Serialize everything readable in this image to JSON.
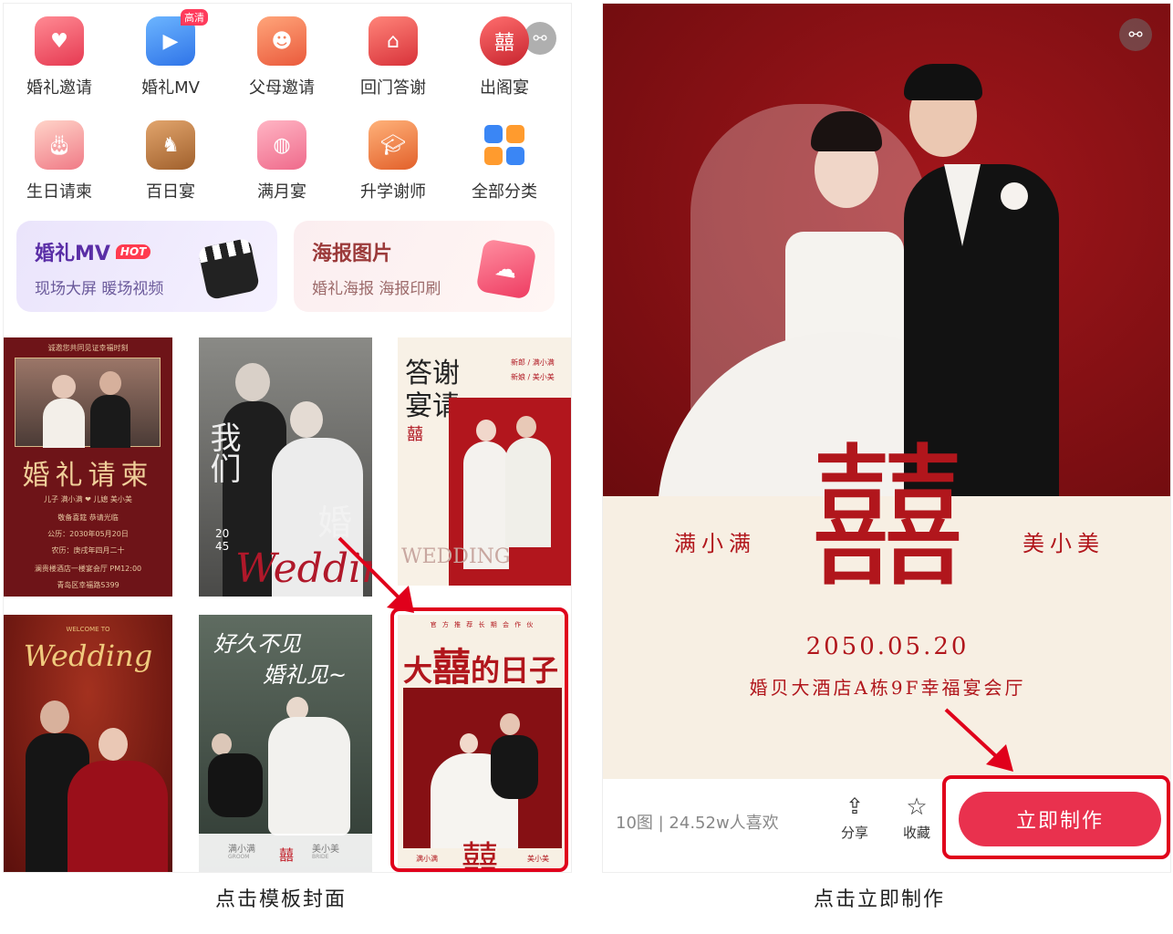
{
  "left_panel": {
    "categories_row1": [
      {
        "label": "婚礼邀请",
        "icon": "envelope-heart-icon",
        "color": "#f25d6b"
      },
      {
        "label": "婚礼MV",
        "icon": "video-icon",
        "color": "#3a8cf0",
        "tag": "高清"
      },
      {
        "label": "父母邀请",
        "icon": "parents-card-icon",
        "color": "#f07552"
      },
      {
        "label": "回门答谢",
        "icon": "pagoda-icon",
        "color": "#ef4e4e"
      },
      {
        "label": "出阁宴",
        "icon": "bride-icon",
        "color": "#e0434b"
      }
    ],
    "categories_row2": [
      {
        "label": "生日请柬",
        "icon": "cake-icon",
        "color": "#f59aa0"
      },
      {
        "label": "百日宴",
        "icon": "rocking-horse-icon",
        "color": "#b8763e"
      },
      {
        "label": "满月宴",
        "icon": "baby-bottle-icon",
        "color": "#f48aa3"
      },
      {
        "label": "升学谢师",
        "icon": "graduation-cap-icon",
        "color": "#ef7a3c"
      },
      {
        "label": "全部分类",
        "icon": "grid-icon",
        "color": "#3b8ef2"
      }
    ],
    "promo_mv": {
      "title": "婚礼MV",
      "badge": "HOT",
      "subtitle": "现场大屏 暖场视频",
      "icon": "clapperboard-icon"
    },
    "promo_poster": {
      "title": "海报图片",
      "subtitle": "婚礼海报 海报印刷",
      "icon": "picture-icon"
    },
    "templates": [
      {
        "name": "婚礼请柬",
        "header": "诚邀您共同见证幸福时刻",
        "line1": "儿子  满小满  ❤  儿媳  美小美",
        "line2": "敬备喜筵 恭请光临",
        "line3": "公历：2030年05月20日",
        "line4": "农历：庚戌年四月二十",
        "line5": "澜贵楼酒店一楼宴会厅 PM12:00",
        "line6": "青岛区幸福路S399"
      },
      {
        "name": "Wedding",
        "side_text1": "我们",
        "side_text2": "婚",
        "year": "20 45"
      },
      {
        "name": "答谢宴请",
        "line1": "答谢",
        "line2": "宴请",
        "groom": "新郎 / 满小满",
        "bride": "新娘 / 美小美",
        "script": "WEDDING"
      },
      {
        "name": "Wedding",
        "welcome": "WELCOME TO"
      },
      {
        "name": "好久不见 婚礼见",
        "line1": "好久不见",
        "line2": "婚礼见~",
        "groom": "满小满",
        "groom_en": "GROOM",
        "bride": "美小美",
        "bride_en": "BRIDE"
      },
      {
        "name": "大囍的日子",
        "top": "官 方 推 荐 长 期 会 作 伙",
        "title_a": "大",
        "title_b": "囍",
        "title_c": "的日子",
        "groom": "满小满",
        "bride": "美小美"
      }
    ],
    "caption": "点击模板封面"
  },
  "right_panel": {
    "groom_name": "满小满",
    "bride_name": "美小美",
    "xi_char": "囍",
    "date": "2050.05.20",
    "venue": "婚贝大酒店A栋9F幸福宴会厅",
    "stats": "10图 | 24.52w人喜欢",
    "share_label": "分享",
    "fav_label": "收藏",
    "make_button": "立即制作",
    "caption": "点击立即制作"
  },
  "colors": {
    "accent": "#e9314e",
    "highlight_frame": "#e0001b",
    "card_red": "#b1161c"
  }
}
